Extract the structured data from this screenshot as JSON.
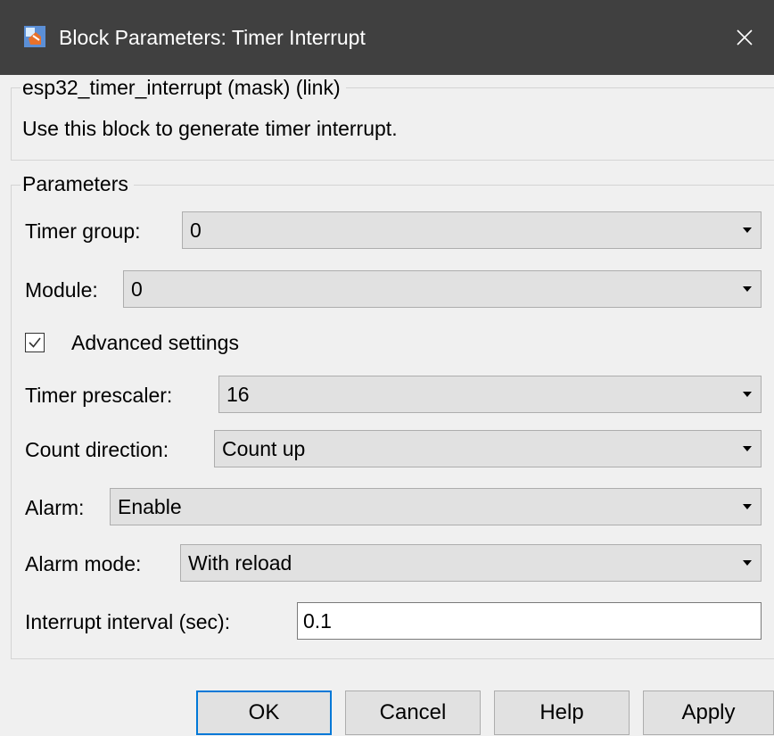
{
  "window": {
    "title": "Block Parameters: Timer Interrupt",
    "close_glyph": "✕",
    "icon": "simulink-block-icon"
  },
  "mask": {
    "legend": "esp32_timer_interrupt (mask) (link)",
    "description": "Use this block to generate timer interrupt."
  },
  "parameters": {
    "legend": "Parameters",
    "timer_group": {
      "label": "Timer group:",
      "value": "0"
    },
    "module": {
      "label": "Module:",
      "value": "0"
    },
    "advanced": {
      "label": "Advanced settings",
      "checked": true
    },
    "timer_prescaler": {
      "label": "Timer prescaler:",
      "value": "16"
    },
    "count_direction": {
      "label": "Count direction:",
      "value": "Count up"
    },
    "alarm": {
      "label": "Alarm:",
      "value": "Enable"
    },
    "alarm_mode": {
      "label": "Alarm mode:",
      "value": "With reload"
    },
    "interrupt_interval": {
      "label": "Interrupt interval (sec):",
      "value": "0.1"
    }
  },
  "buttons": {
    "ok": "OK",
    "cancel": "Cancel",
    "help": "Help",
    "apply": "Apply"
  },
  "colors": {
    "titlebar": "#404040",
    "accent": "#0078d7",
    "control_bg": "#e1e1e1"
  }
}
